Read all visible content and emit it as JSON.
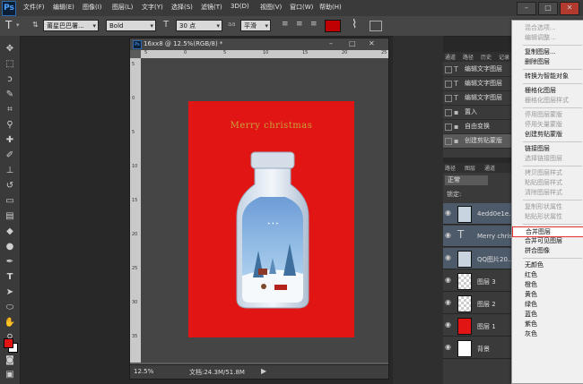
{
  "app": {
    "logo": "Ps"
  },
  "menu": [
    "文件(F)",
    "编辑(E)",
    "图像(I)",
    "图层(L)",
    "文字(Y)",
    "选择(S)",
    "滤镜(T)",
    "3D(D)",
    "视图(V)",
    "窗口(W)",
    "帮助(H)"
  ],
  "options": {
    "tool_glyph": "T",
    "font_family": "莆星巴巴署...",
    "font_style": "Bold",
    "font_size": "30 点",
    "antialias": "平滑",
    "text_color": "#c00000",
    "warp_glyph": "⌇"
  },
  "document": {
    "title": "16xx8 @ 12.5%(RGB/8) *",
    "zoom": "12.5%",
    "doc_info": "文档:24.3M/51.8M",
    "headline": "Merry christmas",
    "ruler_top": [
      "5",
      "0",
      "5",
      "10",
      "15",
      "20",
      "25"
    ],
    "ruler_left": [
      "5",
      "0",
      "5",
      "10",
      "15",
      "20",
      "25",
      "30",
      "35"
    ],
    "bg_color": "#e11614",
    "headline_color": "#c9a23a"
  },
  "history": {
    "tabs": [
      "通道",
      "路径",
      "历史",
      "记录"
    ],
    "items": [
      "编辑文字图层",
      "编辑文字图层",
      "编辑文字图层",
      "置入",
      "自由变换",
      "创建剪贴蒙版"
    ]
  },
  "layers": {
    "tabs": [
      "路径",
      "图层",
      "通道"
    ],
    "blend_mode": "正常",
    "lock_label": "锁定:",
    "items": [
      {
        "name": "4edd0e1e...",
        "kind": "image"
      },
      {
        "name": "Merry christ...",
        "kind": "text"
      },
      {
        "name": "QQ图片20...",
        "kind": "image"
      },
      {
        "name": "图层 3",
        "kind": "layer"
      },
      {
        "name": "图层 2",
        "kind": "layer"
      },
      {
        "name": "图层 1",
        "kind": "red"
      },
      {
        "name": "背景",
        "kind": "bg"
      }
    ]
  },
  "context_menu": {
    "items": [
      {
        "label": "混合选项...",
        "disabled": true
      },
      {
        "label": "编辑调整...",
        "disabled": true
      },
      {
        "sep": true
      },
      {
        "label": "复制图层..."
      },
      {
        "label": "删除图层"
      },
      {
        "sep": true
      },
      {
        "label": "转换为智能对象"
      },
      {
        "sep": true
      },
      {
        "label": "栅格化图层"
      },
      {
        "label": "栅格化图层样式",
        "disabled": true
      },
      {
        "sep": true
      },
      {
        "label": "停用图层蒙版",
        "disabled": true
      },
      {
        "label": "停用矢量蒙版",
        "disabled": true
      },
      {
        "label": "创建剪贴蒙版"
      },
      {
        "sep": true
      },
      {
        "label": "链接图层"
      },
      {
        "label": "选择链接图层",
        "disabled": true
      },
      {
        "sep": true
      },
      {
        "label": "拷贝图层样式",
        "disabled": true
      },
      {
        "label": "粘贴图层样式",
        "disabled": true
      },
      {
        "label": "清除图层样式",
        "disabled": true
      },
      {
        "sep": true
      },
      {
        "label": "复制形状属性",
        "disabled": true
      },
      {
        "label": "粘贴形状属性",
        "disabled": true
      },
      {
        "sep": true
      },
      {
        "label": "合并图层",
        "highlighted": true
      },
      {
        "label": "合并可见图层"
      },
      {
        "label": "拼合图像"
      },
      {
        "sep": true
      },
      {
        "label": "无颜色"
      },
      {
        "label": "红色"
      },
      {
        "label": "橙色"
      },
      {
        "label": "黄色"
      },
      {
        "label": "绿色"
      },
      {
        "label": "蓝色"
      },
      {
        "label": "紫色"
      },
      {
        "label": "灰色"
      }
    ]
  },
  "colors": {
    "foreground": "#e11614",
    "background": "#ffffff"
  }
}
